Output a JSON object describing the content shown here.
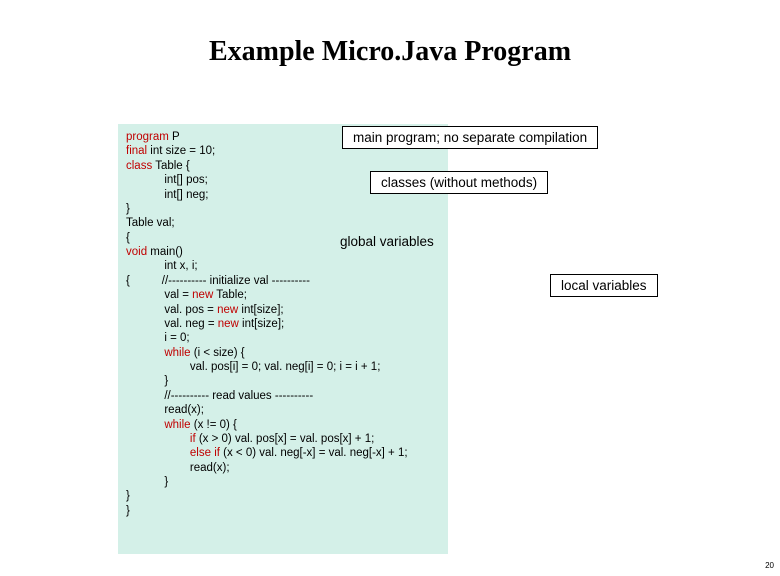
{
  "title": "Example Micro.Java Program",
  "annotations": {
    "main": "main program; no separate compilation",
    "classes": "classes (without methods)",
    "globals": "global variables",
    "locals": "local variables"
  },
  "code": {
    "l01a": "program",
    "l01b": " P",
    "l02a": "final",
    "l02b": " int size = 10;",
    "l03a": "class",
    "l03b": " Table {",
    "l04": "            int[] pos;",
    "l05": "            int[] neg;",
    "l06": "}",
    "l07": "Table val;",
    "l08": "{",
    "l09a": "void",
    "l09b": " main()",
    "l10": "            int x, i;",
    "l11": "{          //---------- initialize val ----------",
    "l12a": "            val = ",
    "l12b": "new",
    "l12c": " Table;",
    "l13a": "            val. pos = ",
    "l13b": "new",
    "l13c": " int[size];",
    "l14a": "            val. neg = ",
    "l14b": "new",
    "l14c": " int[size];",
    "l15": "            i = 0;",
    "l16a": "            ",
    "l16b": "while",
    "l16c": " (i < size) {",
    "l17": "                    val. pos[i] = 0; val. neg[i] = 0; i = i + 1;",
    "l18": "            }",
    "l19": "            //---------- read values ----------",
    "l20": "            read(x);",
    "l21a": "            ",
    "l21b": "while",
    "l21c": " (x != 0) {",
    "l22a": "                    ",
    "l22b": "if",
    "l22c": " (x > 0) val. pos[x] = val. pos[x] + 1;",
    "l23a": "                    ",
    "l23b": "else if",
    "l23c": " (x < 0) val. neg[-x] = val. neg[-x] + 1;",
    "l24": "                    read(x);",
    "l25": "            }",
    "l26": "}",
    "l27": "}"
  },
  "page_number": "20"
}
